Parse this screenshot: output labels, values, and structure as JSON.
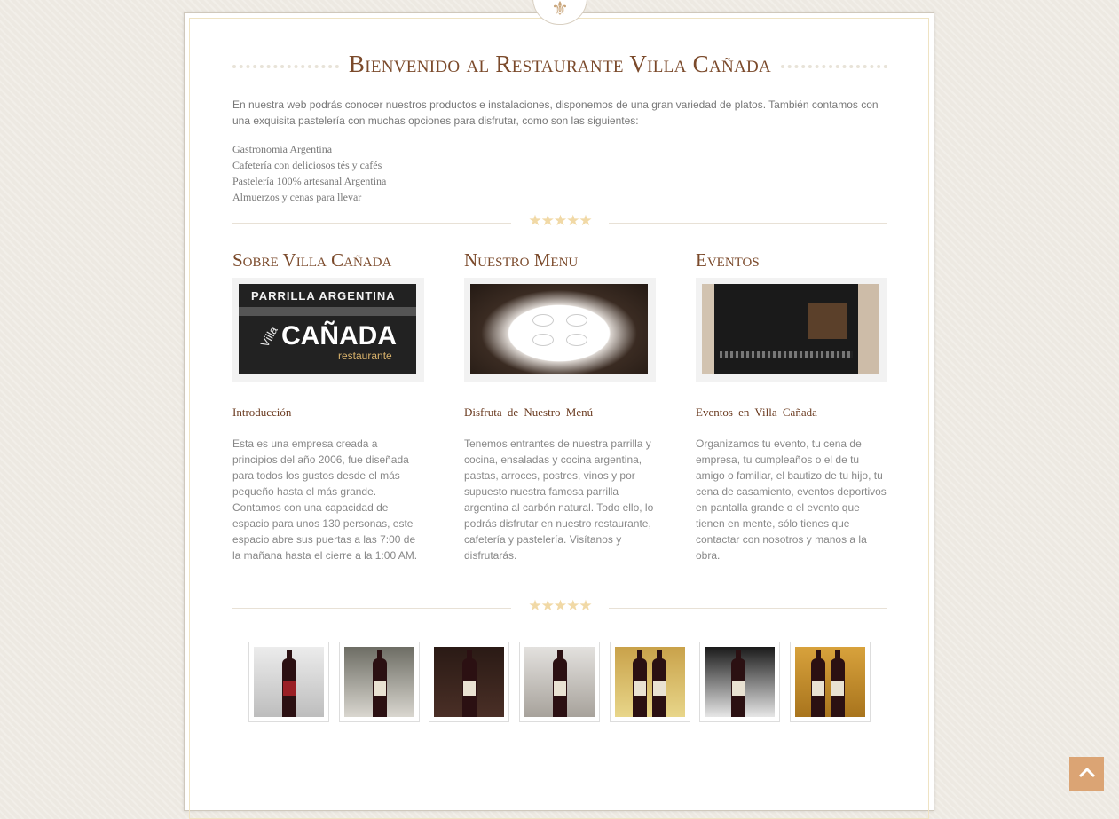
{
  "header": {
    "crest_icon": "fleur-de-lis-icon",
    "title": "Bienvenido al Restaurante Villa Cañada"
  },
  "intro": {
    "text": "En nuestra web podrás conocer nuestros productos e instalaciones, disponemos de una gran variedad de platos. También contamos con una exquisita pastelería con muchas opciones para disfrutar, como son las siguientes:",
    "features": [
      "Gastronomía Argentina",
      "Cafetería con deliciosos tés y cafés",
      "Pastelería 100% artesanal Argentina",
      "Almuerzos y cenas para llevar"
    ]
  },
  "divider": {
    "stars": "★★★★★"
  },
  "columns": [
    {
      "title": "Sobre Villa Cañada",
      "image": {
        "line1": "PARRILLA ARGENTINA",
        "line2": "CAÑADA",
        "line3": "Villa",
        "line4": "restaurante"
      },
      "subtitle": "Introducción",
      "text": "Esta es una empresa creada a principios del año 2006, fue diseñada para todos los gustos desde el más pequeño hasta el más grande. Contamos con una capacidad de espacio para unos 130 personas, este espacio abre sus puertas a las 7:00 de la mañana hasta el cierre a la 1:00 AM."
    },
    {
      "title": "Nuestro Menu",
      "subtitle": "Disfruta de Nuestro Menú",
      "text": "Tenemos entrantes de nuestra parrilla y cocina, ensaladas y cocina argentina, pastas, arroces, postres, vinos y por supuesto nuestra famosa parrilla argentina al carbón natural. Todo ello, lo podrás disfrutar en nuestro restaurante, cafetería y pastelería. Visítanos y disfrutarás."
    },
    {
      "title": "Eventos",
      "subtitle": "Eventos en Villa Cañada",
      "text": "Organizamos tu evento, tu cena de empresa, tu cumpleaños o el de tu amigo o familiar, el bautizo de tu hijo, tu cena de casamiento, eventos deportivos en pantalla grande o el evento que tienen en mente, sólo tienes que contactar con nosotros y manos a la obra."
    }
  ],
  "gallery": {
    "count": 7
  },
  "scroll_top": {
    "icon": "chevron-up-icon",
    "color": "#dba474"
  },
  "colors": {
    "accent": "#7b4a2b",
    "star": "#f1d9a6",
    "background": "#ede9e2"
  }
}
